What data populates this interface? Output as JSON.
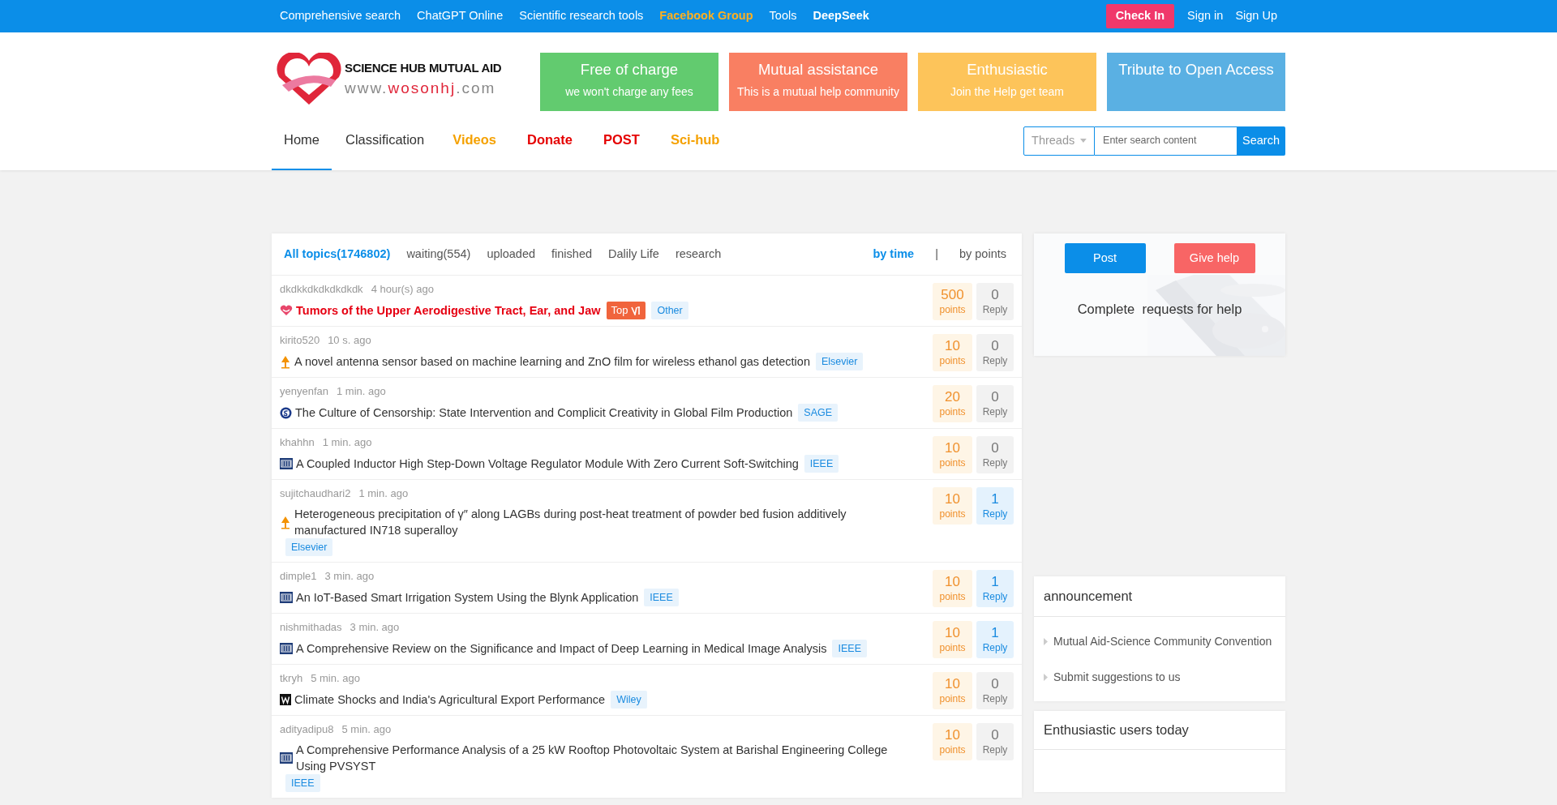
{
  "topbar": {
    "links": [
      {
        "label": "Comprehensive search",
        "kind": "plain"
      },
      {
        "label": "ChatGPT Online",
        "kind": "plain"
      },
      {
        "label": "Scientific research tools",
        "kind": "plain"
      },
      {
        "label": "Facebook Group",
        "kind": "highlight"
      },
      {
        "label": "Tools",
        "kind": "plain"
      },
      {
        "label": "DeepSeek",
        "kind": "bold"
      }
    ],
    "check_in": "Check In",
    "sign_in": "Sign in",
    "sign_up": "Sign Up"
  },
  "logo": {
    "title": "SCIENCE HUB MUTUAL AID",
    "url_parts": [
      {
        "text": "www.",
        "accent": false
      },
      {
        "text": "wosonhj",
        "accent": true
      },
      {
        "text": ".com",
        "accent": false
      }
    ]
  },
  "promos": [
    {
      "title": "Free of charge",
      "subtitle": "we won't charge any fees",
      "color": "#62cb6f"
    },
    {
      "title": "Mutual assistance",
      "subtitle": "This is a mutual help community",
      "color": "#f97f62"
    },
    {
      "title": "Enthusiastic",
      "subtitle": "Join the Help get team",
      "color": "#fdc45a"
    },
    {
      "title": "Tribute to Open Access",
      "color": "#5ab0e3"
    }
  ],
  "nav": [
    {
      "label": "Home",
      "selected": true,
      "color": "#333333"
    },
    {
      "label": "Classification",
      "selected": false,
      "color": "#333333"
    },
    {
      "label": "Videos",
      "selected": false,
      "color": "#f5a100"
    },
    {
      "label": "Donate",
      "selected": false,
      "color": "#e50000"
    },
    {
      "label": "POST",
      "selected": false,
      "color": "#e50000"
    },
    {
      "label": "Sci-hub",
      "selected": false,
      "color": "#f5a100"
    }
  ],
  "search": {
    "scope": "Threads",
    "placeholder": "Enter search content",
    "button": "Search"
  },
  "filters": [
    {
      "label": "All topics(1746802)",
      "selected": true
    },
    {
      "label": "waiting(554)",
      "selected": false
    },
    {
      "label": "uploaded",
      "selected": false
    },
    {
      "label": "finished",
      "selected": false
    },
    {
      "label": "Dalily Life",
      "selected": false
    },
    {
      "label": "research",
      "selected": false
    }
  ],
  "sort": {
    "options": [
      {
        "label": "by time",
        "selected": true
      },
      {
        "label": "by points",
        "selected": false
      }
    ],
    "separator": "|"
  },
  "topics": [
    {
      "user": "dkdkkdkdkdkdkdk",
      "time": "4 hour(s) ago",
      "kind": "heart",
      "title": "Tumors of the Upper Aerodigestive Tract, Ear, and Jaw",
      "featured": true,
      "badge": "Top",
      "tag": "Other",
      "points": "500",
      "points_label": "points",
      "replies": "0",
      "replies_label": "Reply",
      "answered": false
    },
    {
      "user": "kirito520",
      "time": "10 s. ago",
      "kind": "elsevier",
      "title": "A novel antenna sensor based on machine learning and ZnO film for wireless ethanol gas detection",
      "featured": false,
      "tag": "Elsevier",
      "points": "10",
      "points_label": "points",
      "replies": "0",
      "replies_label": "Reply",
      "answered": false
    },
    {
      "user": "yenyenfan",
      "time": "1 min. ago",
      "kind": "sage",
      "title": "The Culture of Censorship: State Intervention and Complicit Creativity in Global Film Production",
      "featured": false,
      "tag": "SAGE",
      "points": "20",
      "points_label": "points",
      "replies": "0",
      "replies_label": "Reply",
      "answered": false
    },
    {
      "user": "khahhn",
      "time": "1 min. ago",
      "kind": "ieee",
      "title": "A Coupled Inductor High Step-Down Voltage Regulator Module With Zero Current Soft-Switching",
      "featured": false,
      "tag": "IEEE",
      "points": "10",
      "points_label": "points",
      "replies": "0",
      "replies_label": "Reply",
      "answered": false
    },
    {
      "user": "sujitchaudhari2",
      "time": "1 min. ago",
      "kind": "elsevier",
      "title": "Heterogeneous precipitation of γ″ along LAGBs during post-heat treatment of powder bed fusion additively manufactured IN718 superalloy",
      "featured": false,
      "tag": "Elsevier",
      "points": "10",
      "points_label": "points",
      "replies": "1",
      "replies_label": "Reply",
      "answered": true
    },
    {
      "user": "dimple1",
      "time": "3 min. ago",
      "kind": "ieee",
      "title": "An IoT-Based Smart Irrigation System Using the Blynk Application",
      "featured": false,
      "tag": "IEEE",
      "points": "10",
      "points_label": "points",
      "replies": "1",
      "replies_label": "Reply",
      "answered": true
    },
    {
      "user": "nishmithadas",
      "time": "3 min. ago",
      "kind": "ieee",
      "title": "A Comprehensive Review on the Significance and Impact of Deep Learning in Medical Image Analysis",
      "featured": false,
      "tag": "IEEE",
      "points": "10",
      "points_label": "points",
      "replies": "1",
      "replies_label": "Reply",
      "answered": true
    },
    {
      "user": "tkryh",
      "time": "5 min. ago",
      "kind": "wiley",
      "title": "Climate Shocks and India's Agricultural Export Performance",
      "featured": false,
      "tag": "Wiley",
      "points": "10",
      "points_label": "points",
      "replies": "0",
      "replies_label": "Reply",
      "answered": false
    },
    {
      "user": "adityadipu8",
      "time": "5 min. ago",
      "kind": "ieee",
      "title": "A Comprehensive Performance Analysis of a 25 kW Rooftop Photovoltaic System at Barishal Engineering College Using PVSYST",
      "featured": false,
      "tag": "IEEE",
      "points": "10",
      "points_label": "points",
      "replies": "0",
      "replies_label": "Reply",
      "answered": false
    }
  ],
  "help_card": {
    "post": "Post",
    "give_help": "Give help",
    "caption": "Complete  requests for help"
  },
  "announcement": {
    "title": "announcement",
    "items": [
      "Mutual Aid-Science Community Convention",
      "Submit suggestions to us"
    ]
  },
  "users_today": {
    "title": "Enthusiastic users today"
  }
}
